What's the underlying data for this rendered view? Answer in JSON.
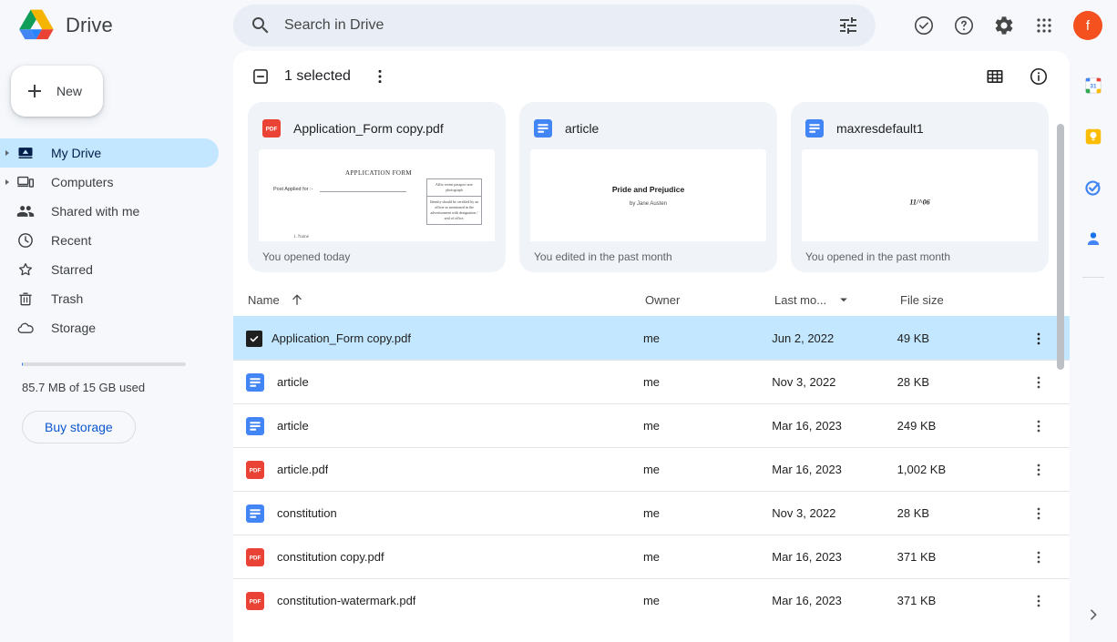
{
  "app": {
    "name": "Drive",
    "logo_icon": "drive-logo"
  },
  "search": {
    "placeholder": "Search in Drive",
    "value": "",
    "search_icon": "search-icon",
    "tune_icon": "tune-icon"
  },
  "topbar_actions": [
    {
      "icon": "check-circle-icon",
      "name": "activity-button"
    },
    {
      "icon": "help-icon",
      "name": "help-button"
    },
    {
      "icon": "gear-icon",
      "name": "settings-button"
    },
    {
      "icon": "apps-grid-icon",
      "name": "google-apps-button"
    }
  ],
  "account": {
    "initial": "f",
    "color": "#f4511e"
  },
  "sidebar": {
    "new_button": {
      "label": "New",
      "icon": "plus-icon"
    },
    "items": [
      {
        "label": "My Drive",
        "icon": "my-drive-icon",
        "active": true,
        "expandable": true
      },
      {
        "label": "Computers",
        "icon": "computer-icon",
        "active": false,
        "expandable": true
      },
      {
        "label": "Shared with me",
        "icon": "people-icon",
        "active": false,
        "expandable": false
      },
      {
        "label": "Recent",
        "icon": "clock-icon",
        "active": false,
        "expandable": false
      },
      {
        "label": "Starred",
        "icon": "star-icon",
        "active": false,
        "expandable": false
      },
      {
        "label": "Trash",
        "icon": "trash-icon",
        "active": false,
        "expandable": false
      },
      {
        "label": "Storage",
        "icon": "cloud-icon",
        "active": false,
        "expandable": false
      }
    ],
    "storage": {
      "text": "85.7 MB of 15 GB used",
      "used_percent": 0.56,
      "buy_label": "Buy storage"
    }
  },
  "main_toolbar": {
    "selection_label": "1 selected",
    "checkbox_state": "indeterminate",
    "more_icon": "more-vert-icon",
    "grid_view_icon": "grid-view-icon",
    "info_icon": "info-icon"
  },
  "suggested_cards": [
    {
      "title": "Application_Form copy.pdf",
      "file_type": "pdf",
      "activity": "You opened today",
      "thumbnail": {
        "kind": "application-form",
        "heading": "APPLICATION FORM",
        "field_label": "Post Applied for  :-",
        "photo_box_top": "Affix recent passport size photograph",
        "photo_box_bottom": "Identity should be certified by an officer as mentioned in the advertisement with designation / seal of office."
      }
    },
    {
      "title": "article",
      "file_type": "doc",
      "activity": "You edited in the past month",
      "thumbnail": {
        "kind": "doc",
        "heading": "Pride and Prejudice",
        "subheading": "by Jane Austen"
      }
    },
    {
      "title": "maxresdefault1",
      "file_type": "doc",
      "activity": "You opened in the past month",
      "thumbnail": {
        "kind": "number",
        "text": "11/^06"
      }
    }
  ],
  "file_table": {
    "columns": {
      "name": "Name",
      "owner": "Owner",
      "modified": "Last mo...",
      "size": "File size"
    },
    "sort": {
      "column": "name",
      "direction": "asc"
    },
    "rows": [
      {
        "name": "Application_Form copy.pdf",
        "file_type": "pdf",
        "owner": "me",
        "modified": "Jun 2, 2022",
        "size": "49 KB",
        "selected": true
      },
      {
        "name": "article",
        "file_type": "doc",
        "owner": "me",
        "modified": "Nov 3, 2022",
        "size": "28 KB",
        "selected": false
      },
      {
        "name": "article",
        "file_type": "doc",
        "owner": "me",
        "modified": "Mar 16, 2023",
        "size": "249 KB",
        "selected": false
      },
      {
        "name": "article.pdf",
        "file_type": "pdf",
        "owner": "me",
        "modified": "Mar 16, 2023",
        "size": "1,002 KB",
        "selected": false
      },
      {
        "name": "constitution",
        "file_type": "doc",
        "owner": "me",
        "modified": "Nov 3, 2022",
        "size": "28 KB",
        "selected": false
      },
      {
        "name": "constitution copy.pdf",
        "file_type": "pdf",
        "owner": "me",
        "modified": "Mar 16, 2023",
        "size": "371 KB",
        "selected": false
      },
      {
        "name": "constitution-watermark.pdf",
        "file_type": "pdf",
        "owner": "me",
        "modified": "Mar 16, 2023",
        "size": "371 KB",
        "selected": false
      }
    ]
  },
  "right_rail": {
    "items": [
      {
        "icon": "google-calendar-icon",
        "name": "calendar-button"
      },
      {
        "icon": "google-keep-icon",
        "name": "keep-button"
      },
      {
        "icon": "google-tasks-icon",
        "name": "tasks-button"
      },
      {
        "icon": "google-contacts-icon",
        "name": "contacts-button"
      }
    ],
    "expand_icon": "chevron-right-icon"
  },
  "colors": {
    "accent_blue": "#1a73e8",
    "selection_blue": "#c2e7ff",
    "pdf_red": "#ea4335",
    "doc_blue": "#4285f4",
    "page_bg": "#f6f8fc",
    "panel_bg": "#ffffff"
  }
}
